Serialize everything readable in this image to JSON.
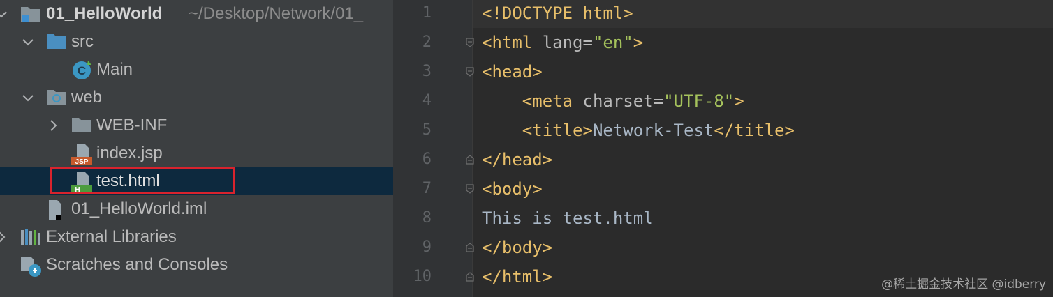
{
  "project_tree": {
    "root": {
      "name": "01_HelloWorld",
      "path": "~/Desktop/Network/01_"
    },
    "items": [
      {
        "label": "src"
      },
      {
        "label": "Main"
      },
      {
        "label": "web"
      },
      {
        "label": "WEB-INF"
      },
      {
        "label": "index.jsp",
        "badge": "JSP"
      },
      {
        "label": "test.html",
        "badge": "H",
        "selected": true
      },
      {
        "label": "01_HelloWorld.iml"
      },
      {
        "label": "External Libraries"
      },
      {
        "label": "Scratches and Consoles"
      }
    ]
  },
  "editor": {
    "line_numbers": [
      "1",
      "2",
      "3",
      "4",
      "5",
      "6",
      "7",
      "8",
      "9",
      "10"
    ],
    "lines": [
      {
        "t1": "<!DOCTYPE html>"
      },
      {
        "t1": "<html",
        "a1": " lang=",
        "s1": "\"en\"",
        "t2": ">"
      },
      {
        "t1": "<head>"
      },
      {
        "indent": "    ",
        "t1": "<meta",
        "a1": " charset=",
        "s1": "\"UTF-8\"",
        "t2": ">"
      },
      {
        "indent": "    ",
        "t1": "<title>",
        "x1": "Network-Test",
        "t2": "</title>"
      },
      {
        "t1": "</head>"
      },
      {
        "t1": "<body>"
      },
      {
        "x1": "This is test.html"
      },
      {
        "t1": "</body>"
      },
      {
        "t1": "</html>"
      }
    ]
  },
  "watermark": "@稀土掘金技术社区 @idberry",
  "colors": {
    "tree_bg": "#3c3f41",
    "editor_bg": "#2b2b2b",
    "selection": "#0d293e",
    "highlight_border": "#d8232d",
    "tag": "#e8bf6a",
    "string": "#a5c25c"
  }
}
